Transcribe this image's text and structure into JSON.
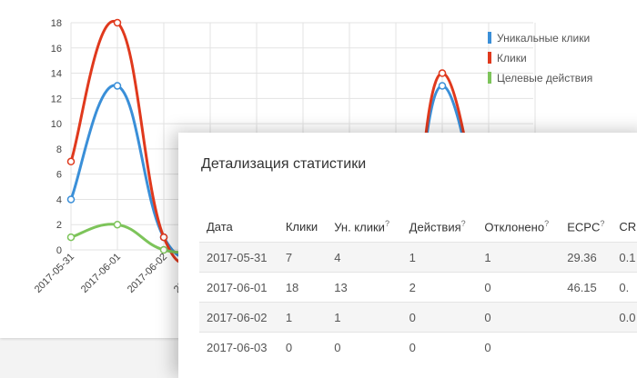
{
  "chart_data": {
    "type": "line",
    "x": [
      "2017-05-31",
      "2017-06-01",
      "2017-06-02",
      "2017-06-03",
      "",
      "",
      "",
      "",
      "",
      "",
      ""
    ],
    "y_ticks": [
      0,
      2,
      4,
      6,
      8,
      10,
      12,
      14,
      16,
      18
    ],
    "ylim": [
      0,
      18
    ],
    "grid": true,
    "legend_position": "top-right",
    "series": [
      {
        "name": "Уникальные клики",
        "color": "#3a8fd8",
        "values": [
          4,
          13,
          1,
          0,
          null,
          null,
          null,
          null,
          13,
          null,
          null
        ]
      },
      {
        "name": "Клики",
        "color": "#e0391d",
        "values": [
          7,
          18,
          1,
          0,
          null,
          null,
          null,
          null,
          14,
          null,
          null
        ]
      },
      {
        "name": "Целевые действия",
        "color": "#7dc45a",
        "values": [
          1,
          2,
          0,
          0,
          null,
          null,
          null,
          null,
          null,
          null,
          null
        ]
      }
    ]
  },
  "detail": {
    "title": "Детализация статистики",
    "headers": [
      {
        "label": "Дата",
        "sup": ""
      },
      {
        "label": "Клики",
        "sup": ""
      },
      {
        "label": "Ун. клики",
        "sup": "?"
      },
      {
        "label": "Действия",
        "sup": "?"
      },
      {
        "label": "Отклонено",
        "sup": "?"
      },
      {
        "label": "ECPC",
        "sup": "?"
      },
      {
        "label": "CR",
        "sup": ""
      }
    ],
    "rows": [
      [
        "2017-05-31",
        "7",
        "4",
        "1",
        "1",
        "29.36",
        "0.1"
      ],
      [
        "2017-06-01",
        "18",
        "13",
        "2",
        "0",
        "46.15",
        "0."
      ],
      [
        "2017-06-02",
        "1",
        "1",
        "0",
        "0",
        "",
        "0.0"
      ],
      [
        "2017-06-03",
        "0",
        "0",
        "0",
        "0",
        "",
        ""
      ]
    ]
  }
}
